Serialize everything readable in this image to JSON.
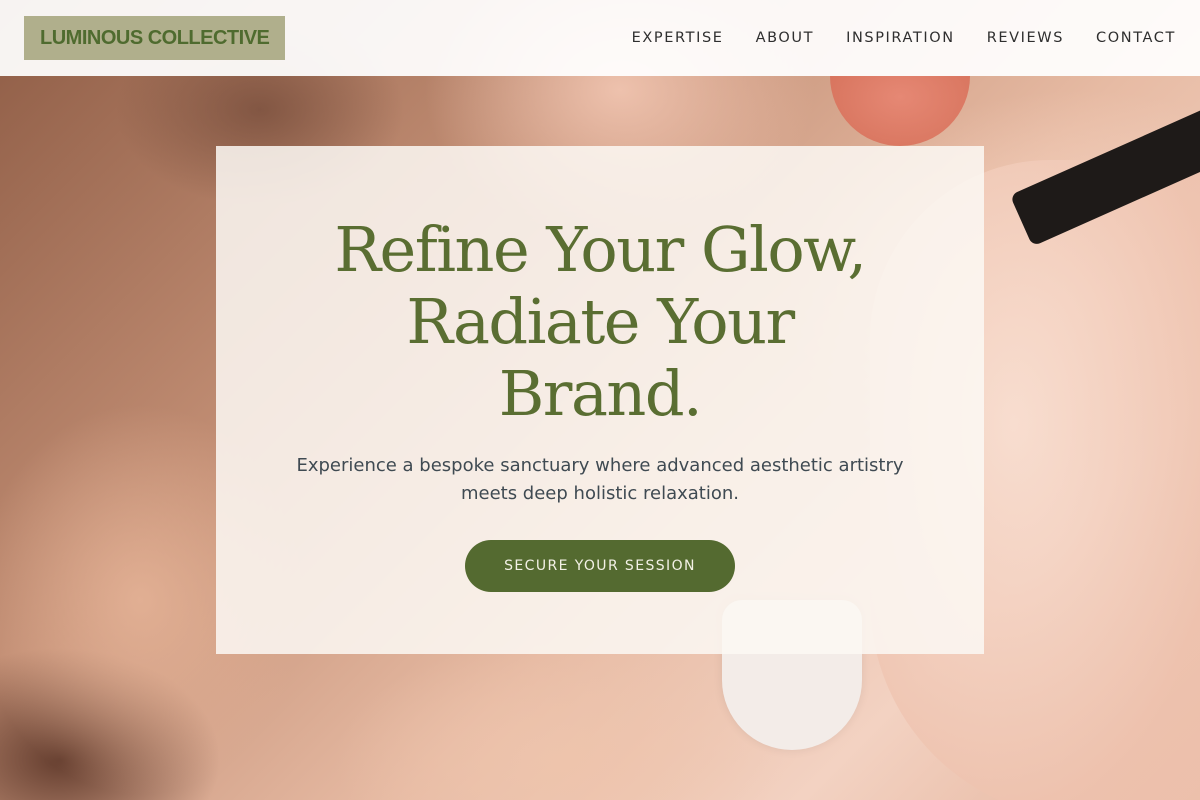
{
  "brand": {
    "name": "LUMINOUS COLLECTIVE"
  },
  "nav": {
    "items": [
      {
        "label": "EXPERTISE"
      },
      {
        "label": "ABOUT"
      },
      {
        "label": "INSPIRATION"
      },
      {
        "label": "REVIEWS"
      },
      {
        "label": "CONTACT"
      }
    ]
  },
  "hero": {
    "title_line1": "Refine Your Glow,",
    "title_line2": "Radiate Your",
    "title_line3": "Brand.",
    "subtitle": "Experience a bespoke sanctuary where advanced aesthetic artistry meets deep holistic relaxation.",
    "cta_label": "SECURE YOUR SESSION"
  },
  "colors": {
    "accent": "#546a30",
    "logo_bg": "#b0af8c",
    "title": "#5a6e32"
  }
}
